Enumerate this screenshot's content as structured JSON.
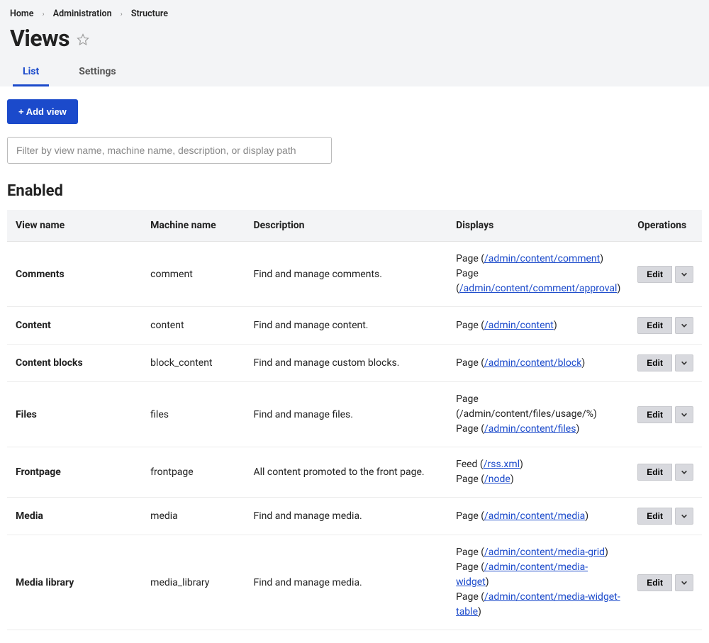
{
  "breadcrumb": {
    "home": "Home",
    "admin": "Administration",
    "structure": "Structure"
  },
  "page_title": "Views",
  "tabs": {
    "list": "List",
    "settings": "Settings"
  },
  "add_button": "+ Add view",
  "filter_placeholder": "Filter by view name, machine name, description, or display path",
  "section_heading": "Enabled",
  "columns": {
    "view_name": "View name",
    "machine_name": "Machine name",
    "description": "Description",
    "displays": "Displays",
    "operations": "Operations"
  },
  "edit_label": "Edit",
  "rows": [
    {
      "view_name": "Comments",
      "machine_name": "comment",
      "description": "Find and manage comments.",
      "displays": [
        {
          "prefix": "Page (",
          "link": "/admin/content/comment",
          "suffix": ")"
        },
        {
          "prefix": "Page (",
          "link": "/admin/content/comment/approval",
          "suffix": ")"
        }
      ]
    },
    {
      "view_name": "Content",
      "machine_name": "content",
      "description": "Find and manage content.",
      "displays": [
        {
          "prefix": "Page (",
          "link": "/admin/content",
          "suffix": ")"
        }
      ]
    },
    {
      "view_name": "Content blocks",
      "machine_name": "block_content",
      "description": "Find and manage custom blocks.",
      "displays": [
        {
          "prefix": "Page (",
          "link": "/admin/content/block",
          "suffix": ")"
        }
      ]
    },
    {
      "view_name": "Files",
      "machine_name": "files",
      "description": "Find and manage files.",
      "displays": [
        {
          "prefix": "Page (/admin/content/files/usage/%)",
          "link": null,
          "suffix": ""
        },
        {
          "prefix": "Page (",
          "link": "/admin/content/files",
          "suffix": ")"
        }
      ]
    },
    {
      "view_name": "Frontpage",
      "machine_name": "frontpage",
      "description": "All content promoted to the front page.",
      "displays": [
        {
          "prefix": "Feed (",
          "link": "/rss.xml",
          "suffix": ")"
        },
        {
          "prefix": "Page (",
          "link": "/node",
          "suffix": ")"
        }
      ]
    },
    {
      "view_name": "Media",
      "machine_name": "media",
      "description": "Find and manage media.",
      "displays": [
        {
          "prefix": "Page (",
          "link": "/admin/content/media",
          "suffix": ")"
        }
      ]
    },
    {
      "view_name": "Media library",
      "machine_name": "media_library",
      "description": "Find and manage media.",
      "displays": [
        {
          "prefix": "Page (",
          "link": "/admin/content/media-grid",
          "suffix": ")"
        },
        {
          "prefix": "Page (",
          "link": "/admin/content/media-widget",
          "suffix": ")"
        },
        {
          "prefix": "Page (",
          "link": "/admin/content/media-widget-table",
          "suffix": ")"
        }
      ]
    }
  ]
}
